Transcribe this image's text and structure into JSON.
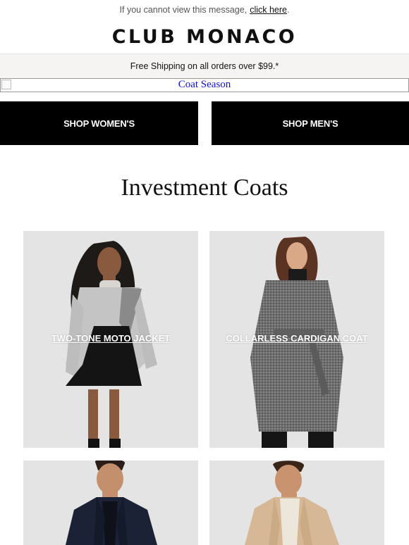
{
  "preheader": {
    "text": "If you cannot view this message,",
    "link": "click here",
    "end": "."
  },
  "brand": {
    "logo": "CLUB MONACO"
  },
  "banner": {
    "shipping": "Free Shipping on all orders over $99.*"
  },
  "hero": {
    "alt_text": "Coat Season"
  },
  "nav": {
    "shop_womens": "SHOP WOMEN'S",
    "shop_mens": "SHOP MEN'S"
  },
  "section": {
    "title": "Investment Coats"
  },
  "products": [
    {
      "label": "TWO-TONE MOTO JACKET"
    },
    {
      "label": "COLLARLESS CARDIGAN COAT"
    },
    {
      "label": ""
    },
    {
      "label": ""
    }
  ],
  "colors": {
    "button_bg": "#000000",
    "button_text": "#ffffff",
    "banner_bg": "#f6f4f2",
    "tile_bg": "#e5e5e5"
  }
}
